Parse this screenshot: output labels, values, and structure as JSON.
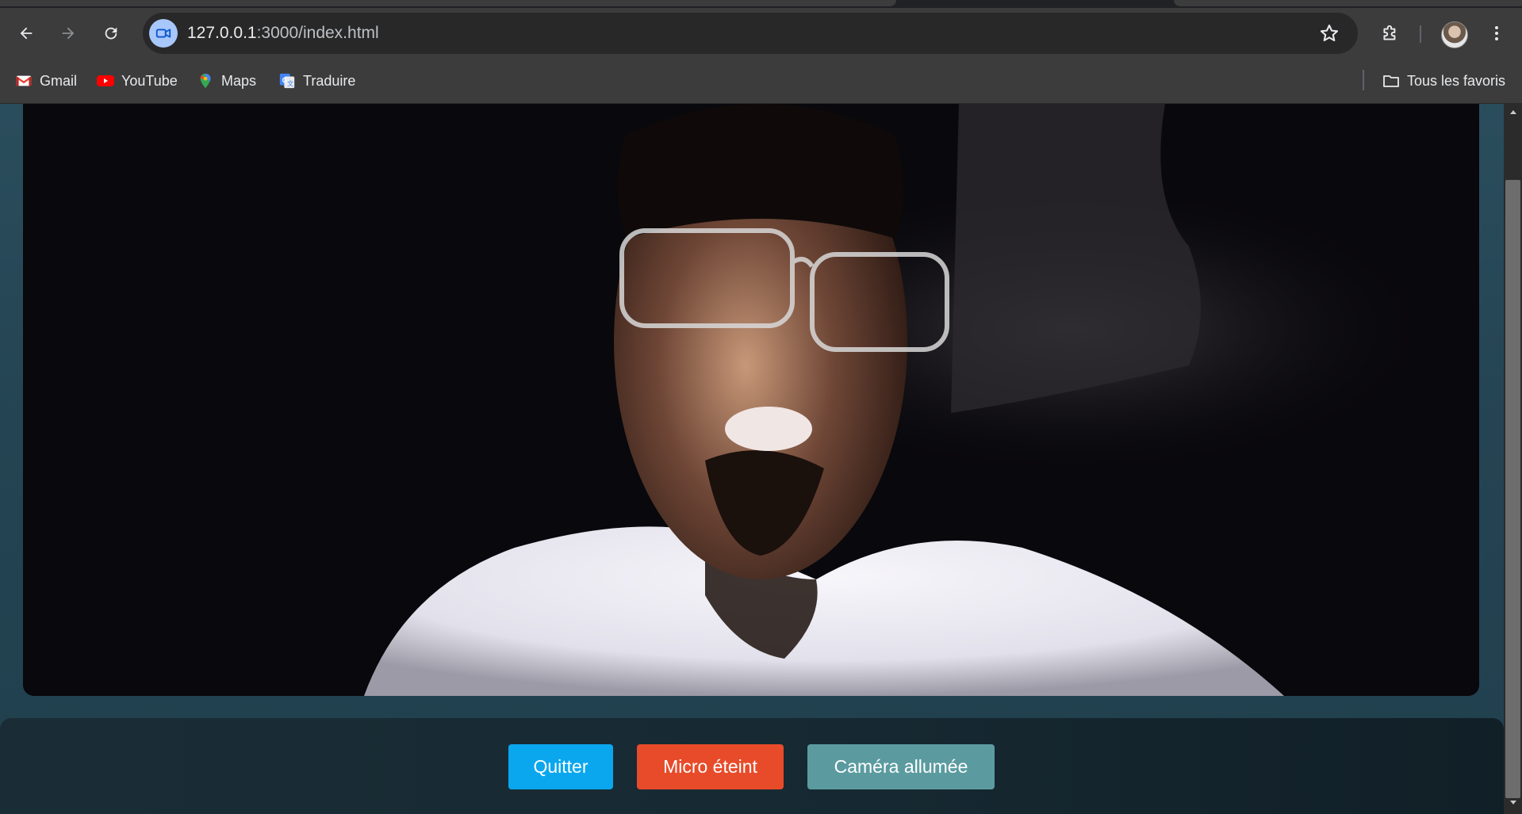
{
  "browser": {
    "url_host": "127.0.0.1",
    "url_path": ":3000/index.html",
    "bookmarks": [
      {
        "label": "Gmail",
        "icon": "gmail-icon"
      },
      {
        "label": "YouTube",
        "icon": "youtube-icon"
      },
      {
        "label": "Maps",
        "icon": "maps-icon"
      },
      {
        "label": "Traduire",
        "icon": "translate-icon"
      }
    ],
    "all_bookmarks_label": "Tous les favoris"
  },
  "controls": {
    "quit_label": "Quitter",
    "mic_label": "Micro éteint",
    "camera_label": "Caméra allumée"
  },
  "colors": {
    "quit": "#0aa7ee",
    "mic": "#e84b2a",
    "camera": "#5b9ba0",
    "page_bg": "#244453"
  }
}
